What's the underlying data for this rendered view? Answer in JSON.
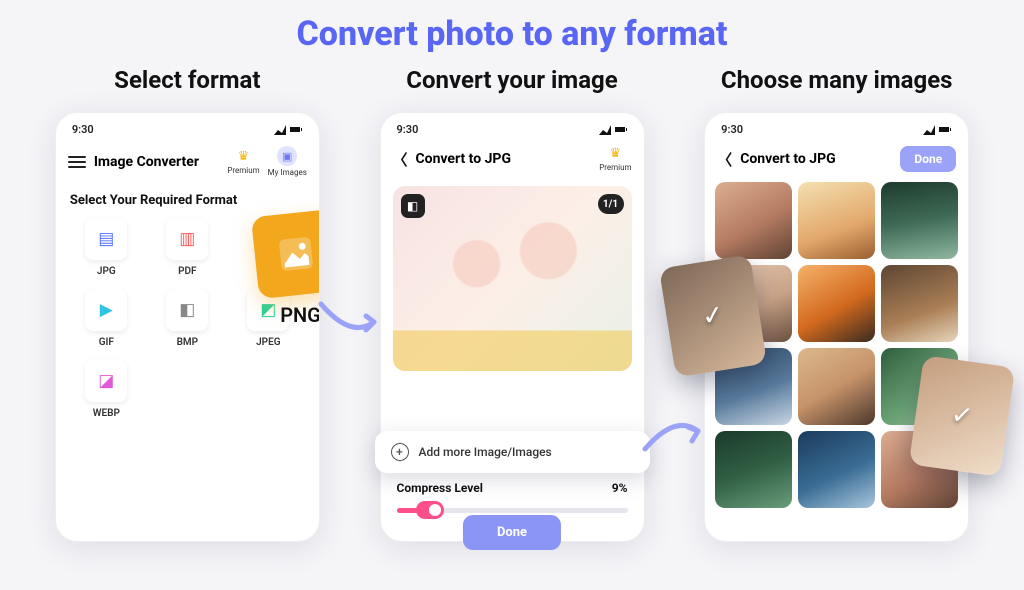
{
  "hero": "Convert photo to any format",
  "columns": {
    "left": "Select format",
    "center": "Convert your image",
    "right": "Choose many images"
  },
  "status_time": "9:30",
  "phone1": {
    "app_title": "Image Converter",
    "premium_label": "Premium",
    "myimages_label": "My Images",
    "section": "Select Your Required Format",
    "formats": [
      "JPG",
      "PDF",
      "",
      "GIF",
      "BMP",
      "JPEG",
      "WEBP"
    ],
    "png_label": "PNG"
  },
  "phone2": {
    "title": "Convert to JPG",
    "premium_label": "Premium",
    "count": "1/1",
    "add_more": "Add more Image/Images",
    "compress_label": "Compress Level",
    "compress_value": "9%",
    "done": "Done"
  },
  "phone3": {
    "title": "Convert to JPG",
    "done": "Done"
  }
}
